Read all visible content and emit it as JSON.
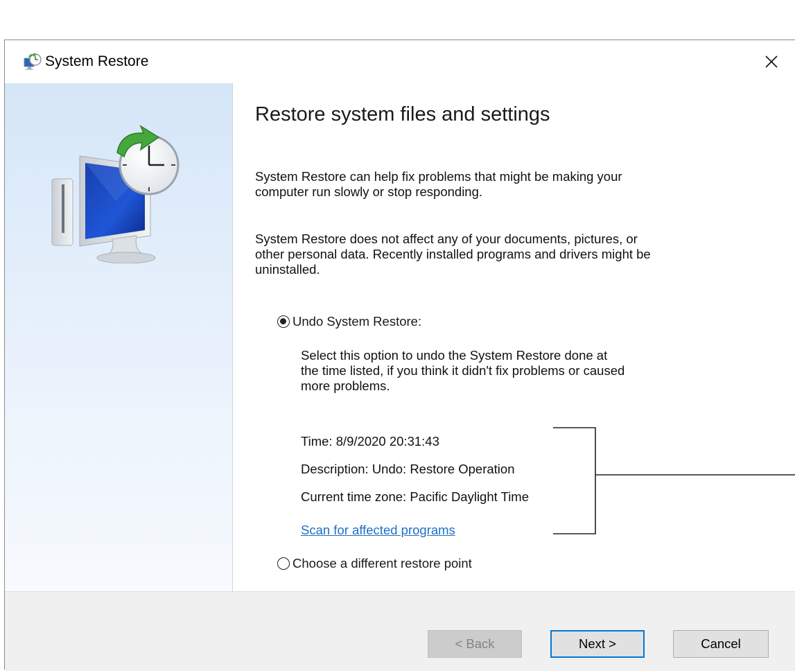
{
  "window": {
    "title": "System Restore",
    "close_glyph": "✕",
    "title_icon": "system-restore-icon"
  },
  "sidebar": {
    "illustration": "system-restore-illustration"
  },
  "main": {
    "heading": "Restore system files and settings",
    "intro_line1": "System Restore can help fix problems that might be making your",
    "intro_line2": "computer run slowly or stop responding.",
    "info_line1": "System Restore does not affect any of your documents, pictures, or",
    "info_line2": "other personal data. Recently installed programs and drivers might be",
    "info_line3": "uninstalled.",
    "options": {
      "undo": {
        "label": "Undo System Restore:",
        "selected": true,
        "desc_line1": "Select this option to undo the System Restore done at",
        "desc_line2": "the time listed, if you think it didn't fix problems or caused",
        "desc_line3": "more problems."
      },
      "choose": {
        "label": "Choose a different restore point",
        "selected": false
      }
    },
    "details": {
      "time": "Time: 8/9/2020 20:31:43",
      "description": "Description: Undo: Restore Operation",
      "timezone": "Current time zone: Pacific Daylight Time",
      "scan_link": "Scan for affected programs"
    }
  },
  "footer": {
    "back_label": "< Back",
    "next_label": "Next >",
    "cancel_label": "Cancel"
  },
  "colors": {
    "link": "#1f6fc5",
    "default_button_border": "#0078d7",
    "sidebar_gradient_top": "#d5e6f8"
  }
}
